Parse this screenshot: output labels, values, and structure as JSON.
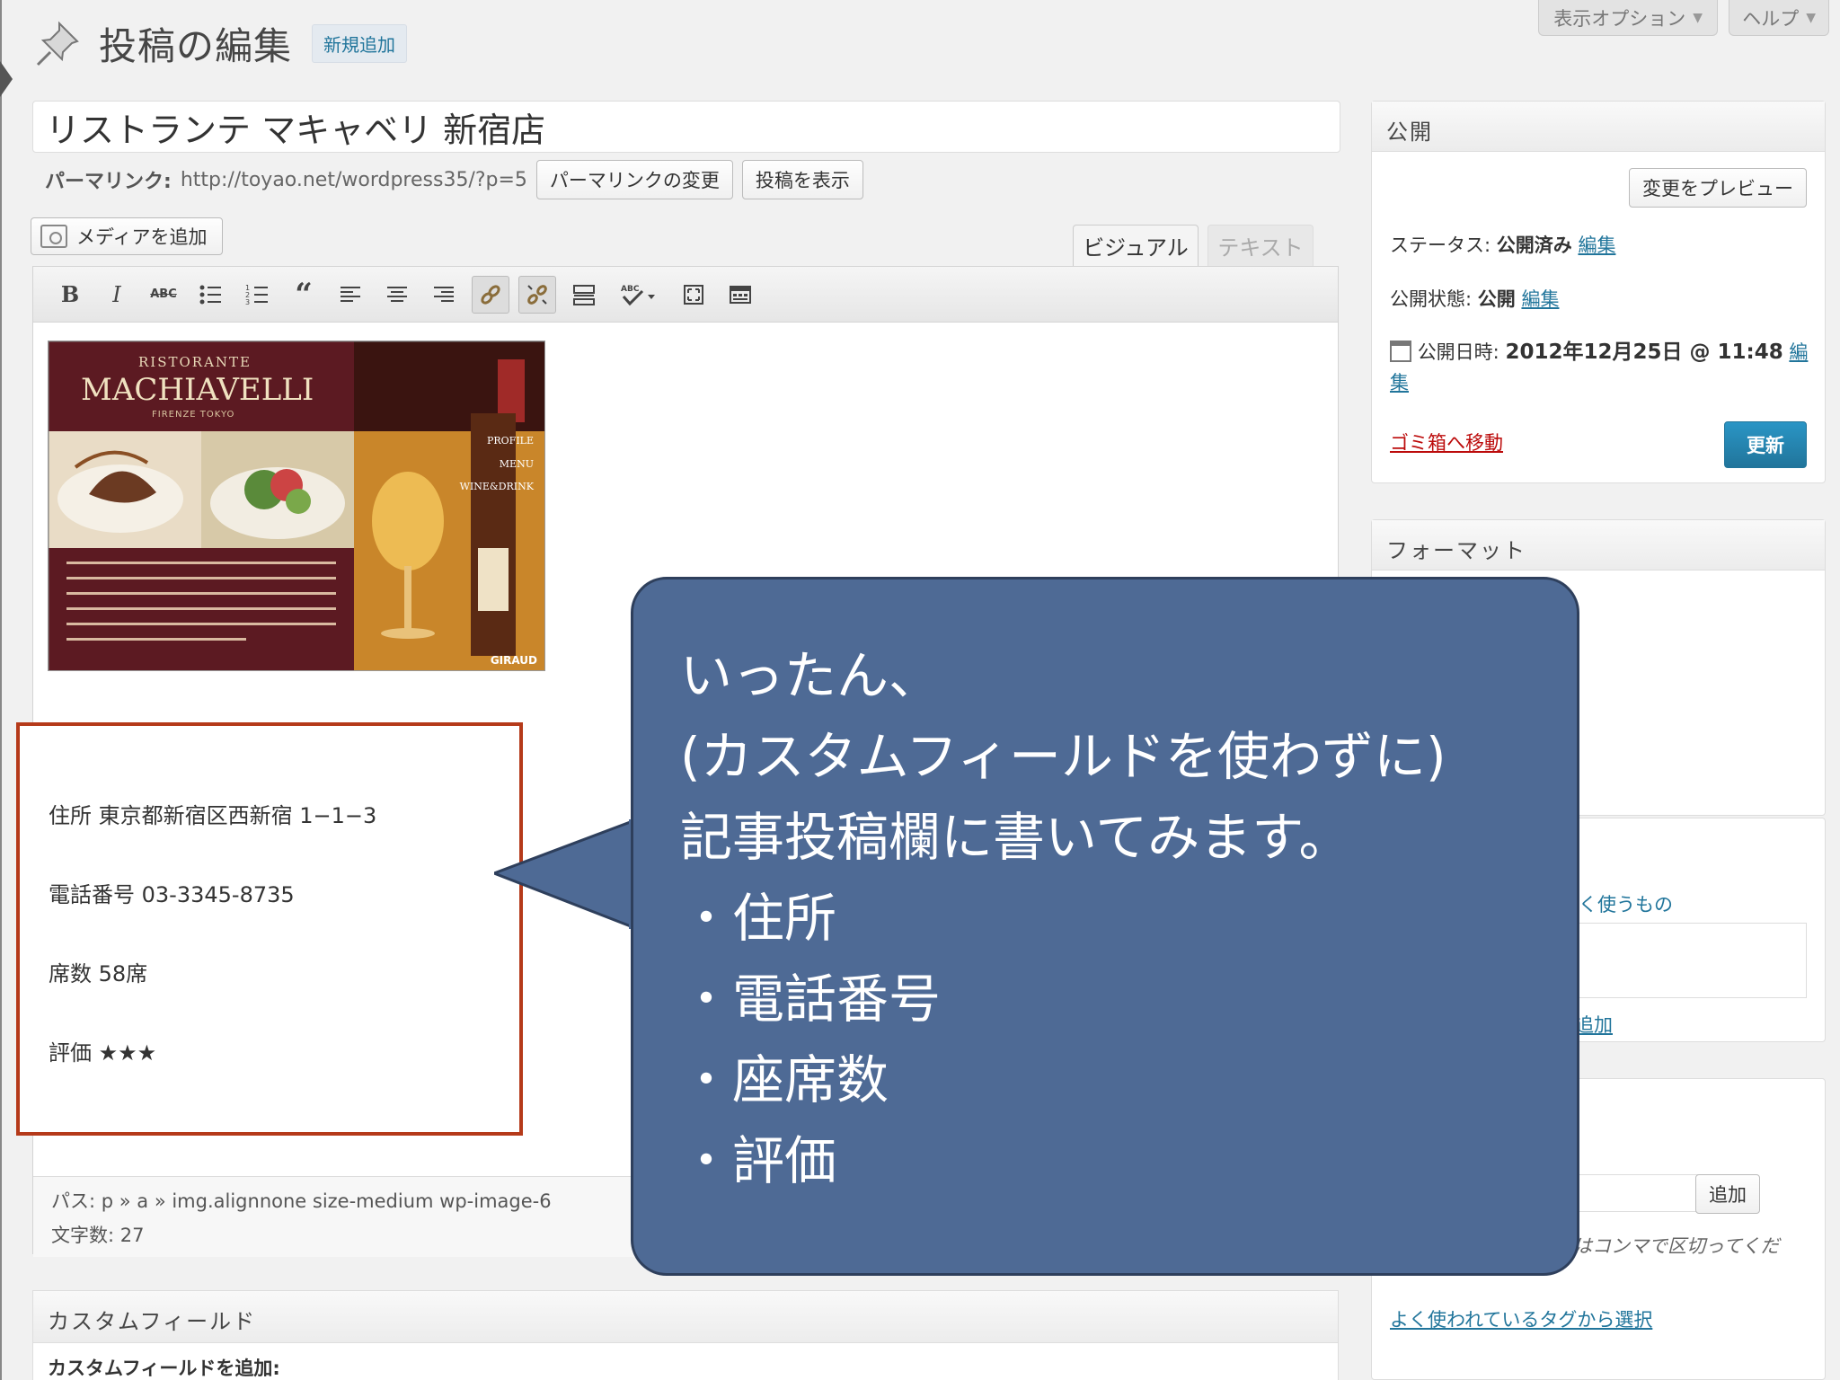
{
  "header": {
    "title": "投稿の編集",
    "add_new": "新規追加",
    "screen_options": "表示オプション",
    "help": "ヘルプ"
  },
  "post": {
    "title": "リストランテ マキャベリ 新宿店",
    "permalink_label": "パーマリンク:",
    "permalink_url": "http://toyao.net/wordpress35/?p=5",
    "change_permalink": "パーマリンクの変更",
    "view_post": "投稿を表示"
  },
  "editor": {
    "add_media": "メディアを追加",
    "tab_visual": "ビジュアル",
    "tab_text": "テキスト",
    "toolbar": [
      "bold",
      "italic",
      "strikethrough",
      "bullet-list",
      "numbered-list",
      "blockquote",
      "align-left",
      "align-center",
      "align-right",
      "insert-link",
      "unlink",
      "insert-more",
      "spellcheck",
      "fullscreen",
      "kitchen-sink"
    ],
    "image": {
      "ristorante": "RISTORANTE",
      "name": "MACHIAVELLI",
      "city": "FIRENZE   TOKYO",
      "menu": [
        "PROFILE",
        "MENU",
        "WINE&DRINK"
      ],
      "brand": "GIRAUD"
    },
    "fields": {
      "address": "住所 東京都新宿区西新宿 1−1−3",
      "phone": "電話番号 03-3345-8735",
      "seats": "席数 58席",
      "rating": "評価 ★★★"
    },
    "path": "パス: p » a » img.alignnone size-medium wp-image-6",
    "word_count": "文字数: 27"
  },
  "custom_fields": {
    "title": "カスタムフィールド",
    "add_label": "カスタムフィールドを追加:"
  },
  "publish": {
    "title": "公開",
    "preview": "変更をプレビュー",
    "status_label": "ステータス:",
    "status_value": "公開済み",
    "visibility_label": "公開状態:",
    "visibility_value": "公開",
    "date_label": "公開日時:",
    "date_value": "2012年12月25日 @ 11:48",
    "edit": "編集",
    "edit_split_1": "編",
    "edit_split_2": "集",
    "trash": "ゴミ箱へ移動",
    "update": "更新"
  },
  "format": {
    "title": "フォーマット"
  },
  "categories": {
    "most_used_partial": "く使うもの",
    "add_partial": "追加"
  },
  "tags": {
    "add_button": "追加",
    "hint_partial": "はコンマで区切ってくだ",
    "choose_link": "よく使われているタグから選択"
  },
  "callout": {
    "lines": [
      "いったん、",
      "(カスタムフィールドを使わずに)",
      "記事投稿欄に書いてみます。",
      "・住所",
      "・電話番号",
      "・座席数",
      "・評価"
    ]
  },
  "colors": {
    "accent_blue": "#21759b",
    "callout_bg": "#4e6a95",
    "highlight_border": "#b53a1a",
    "trash_red": "#bc0b0b"
  }
}
